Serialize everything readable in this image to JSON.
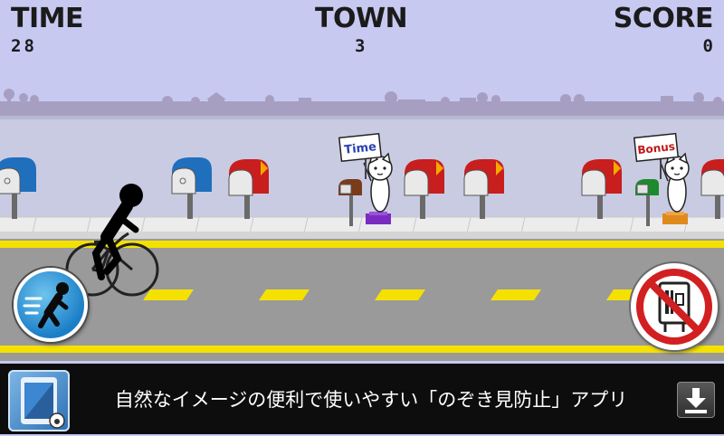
{
  "hud": {
    "time_label": "TIME",
    "time_value": "28",
    "town_label": "TOWN",
    "town_value": "3",
    "score_label": "SCORE",
    "score_value": "0"
  },
  "signs": {
    "left": "Time",
    "right": "Bonus"
  },
  "ad": {
    "text": "自然なイメージの便利で使いやすい「のぞき見防止」アプリ"
  },
  "icons": {
    "dash_button": "runner-icon",
    "stop_button": "no-mailbox-icon",
    "download": "download-icon",
    "app": "phone-app-icon"
  },
  "colors": {
    "sky": "#c7c9f1",
    "road": "#9a9a9a",
    "road_line": "#f5e100",
    "ad_background": "#0d0d0d",
    "dash_button": "#1b7fc8",
    "stop_button": "#d21f22"
  }
}
